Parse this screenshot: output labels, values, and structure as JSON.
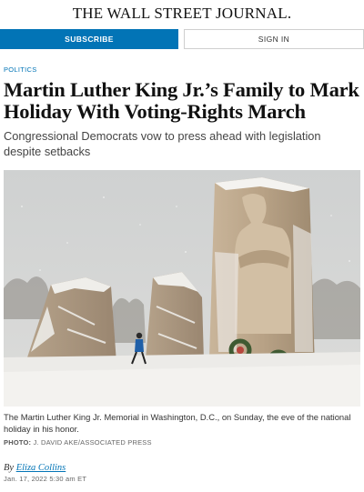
{
  "masthead": {
    "title": "THE WALL STREET JOURNAL."
  },
  "cta": {
    "subscribe_label": "SUBSCRIBE",
    "signin_label": "SIGN IN"
  },
  "article": {
    "section": "POLITICS",
    "headline": "Martin Luther King Jr.’s Family to Mark Holiday With Voting-Rights March",
    "dek": "Congressional Democrats vow to press ahead with legislation despite setbacks",
    "image": {
      "caption": "The Martin Luther King Jr. Memorial in Washington, D.C., on Sunday, the eve of the national holiday in his honor.",
      "credit_label": "PHOTO:",
      "credit_value": "J. DAVID AKE/ASSOCIATED PRESS"
    },
    "byline_prefix": "By",
    "author": "Eliza Collins",
    "timestamp": "Jan. 17, 2022 5:30 am ET"
  },
  "colors": {
    "brand_blue": "#0274b6",
    "text": "#111111"
  }
}
